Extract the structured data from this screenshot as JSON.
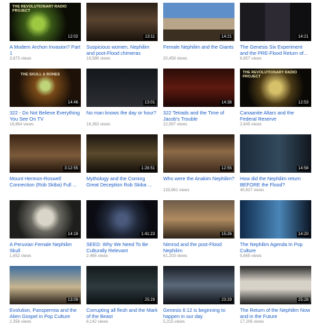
{
  "videos": [
    {
      "title": "A Modern Archon Invasion? Part 1",
      "views": "3,673 views",
      "duration": "12:02",
      "thumb_text": "THE REVOLUTIONARY RADIO PROJECT"
    },
    {
      "title": "Suspicious women, Nephilim and post-Flood chimeras",
      "views": "18,586 views",
      "duration": "13:11",
      "thumb_text": ""
    },
    {
      "title": "Female Nephilim and the Giants",
      "views": "20,459 views",
      "duration": "14:21",
      "thumb_text": ""
    },
    {
      "title": "The Genesis Six Experiment and the PRE-Flood Return of...",
      "views": "6,857 views",
      "duration": "14:21",
      "thumb_text": ""
    },
    {
      "title": "322 - Do Not Believe Everything You See On TV",
      "views": "18,864 views",
      "duration": "14:46",
      "thumb_text": "THE SKULL & BONES"
    },
    {
      "title": "No man knows the day or hour?",
      "views": "16,363 views",
      "duration": "13:01",
      "thumb_text": ""
    },
    {
      "title": "322 Tetrads and the Time of Jacob's Trouble",
      "views": "22,597 views",
      "duration": "14:38",
      "thumb_text": ""
    },
    {
      "title": "Canaanite Altars and the Federal Reserve",
      "views": "2,645 views",
      "duration": "12:53",
      "thumb_text": "THE REVOLUTIONARY RADIO PROJECT"
    },
    {
      "title": "Mount Hermon-Roswell Connection (Rob Skiba) Full ...",
      "views": "",
      "duration": "3:12:55",
      "thumb_text": ""
    },
    {
      "title": "Mythology and the Coming Great Deception Rob Skiba ...",
      "views": "",
      "duration": "1:28:51",
      "thumb_text": ""
    },
    {
      "title": "Who were the Anakim Nephilim?",
      "views": "133,861 views",
      "duration": "12:55",
      "thumb_text": ""
    },
    {
      "title": "How did the Nephilim return BEFORE the Flood?",
      "views": "40,627 views",
      "duration": "14:58",
      "thumb_text": ""
    },
    {
      "title": "A Peruvian Female Nephilim Skull",
      "views": "1,652 views",
      "duration": "14:19",
      "thumb_text": ""
    },
    {
      "title": "SEED: Why We Need To Be Culturally Relevant",
      "views": "2,465 views",
      "duration": "1:41:23",
      "thumb_text": ""
    },
    {
      "title": "Nimrod and the post-Flood Nephilim",
      "views": "61,203 views",
      "duration": "15:26",
      "thumb_text": ""
    },
    {
      "title": "The Nephilim Agenda In Pop Culture",
      "views": "5,665 views",
      "duration": "14:20",
      "thumb_text": ""
    },
    {
      "title": "Evolution, Panspermia and the Alien Gospel in Pop Culture",
      "views": "2,356 views",
      "duration": "13:09",
      "thumb_text": ""
    },
    {
      "title": "Corrupting all flesh and the Mark of the Beast",
      "views": "6,142 views",
      "duration": "25:29",
      "thumb_text": ""
    },
    {
      "title": "Genesis 6:12 is beginning to happen in our day",
      "views": "5,315 views",
      "duration": "23:29",
      "thumb_text": ""
    },
    {
      "title": "The Return of the Nephilim Now and in the Future",
      "views": "17,206 views",
      "duration": "25:28",
      "thumb_text": ""
    }
  ]
}
